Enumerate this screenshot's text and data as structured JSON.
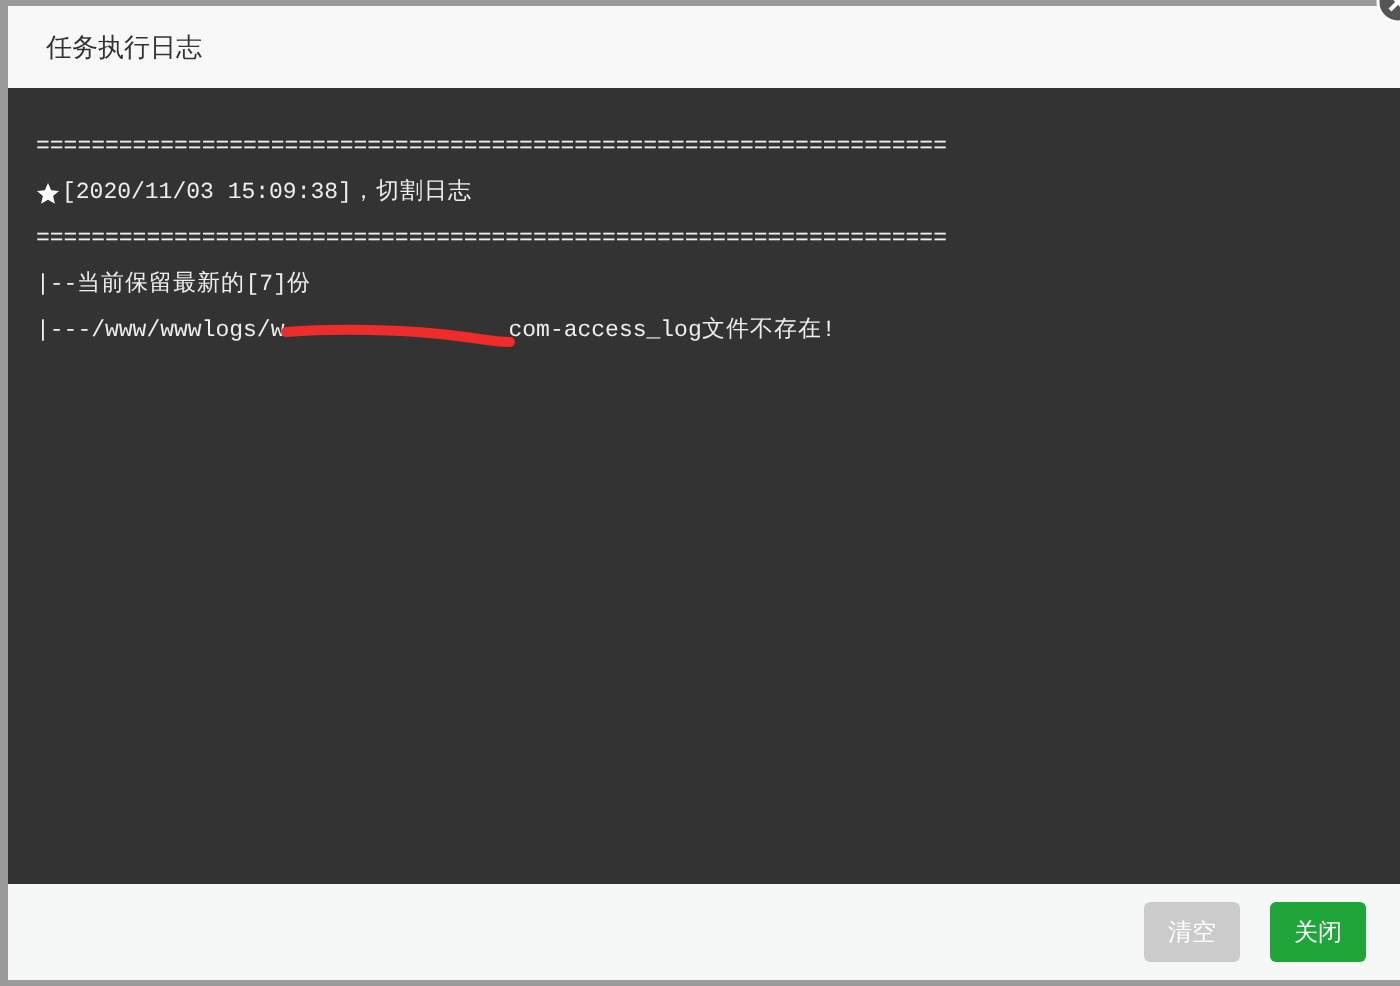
{
  "dialog": {
    "title": "任务执行日志"
  },
  "log": {
    "lines": [
      {
        "kind": "plain",
        "text": "=================================================================="
      },
      {
        "kind": "star",
        "text": "[2020/11/03 15:09:38]，切割日志"
      },
      {
        "kind": "plain",
        "text": "=================================================================="
      },
      {
        "kind": "plain",
        "text": "|--当前保留最新的[7]份"
      },
      {
        "kind": "redacted",
        "before": "|---/www/wwwlogs/w",
        "after": "com-access_log文件不存在!"
      }
    ]
  },
  "buttons": [
    {
      "label": "清空",
      "kind": "secondary",
      "disabled": true
    },
    {
      "label": "关闭",
      "kind": "primary",
      "disabled": false
    }
  ]
}
